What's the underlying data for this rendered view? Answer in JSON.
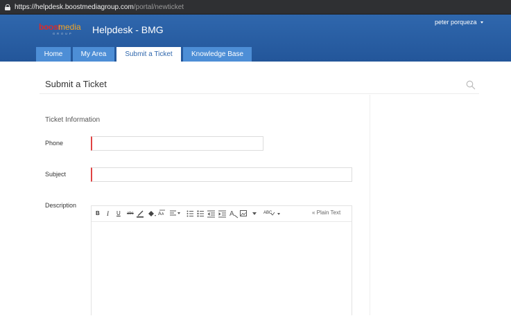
{
  "browser": {
    "url_host": "https://helpdesk.boostmediagroup.com",
    "url_path": "/portal/newticket"
  },
  "header": {
    "logo": {
      "boost": "boost",
      "media": "media",
      "group": "GROUP"
    },
    "title": "Helpdesk - BMG",
    "user_name": "peter porqueza"
  },
  "tabs": [
    {
      "label": "Home",
      "active": false
    },
    {
      "label": "My Area",
      "active": false
    },
    {
      "label": "Submit a Ticket",
      "active": true
    },
    {
      "label": "Knowledge Base",
      "active": false
    }
  ],
  "main": {
    "title": "Submit a Ticket",
    "section_title": "Ticket Information",
    "fields": {
      "phone": {
        "label": "Phone",
        "value": ""
      },
      "subject": {
        "label": "Subject",
        "value": ""
      },
      "description": {
        "label": "Description",
        "value": ""
      }
    },
    "editor": {
      "toolbar": {
        "bold": "B",
        "italic": "I",
        "underline": "U",
        "strike": "abc",
        "spell_check": "ABC",
        "plain_text": "« Plain Text"
      }
    }
  },
  "colors": {
    "header_blue": "#2f67ad",
    "tab_blue": "#4d8ed6",
    "required_red": "#e04343",
    "browser_bar": "#2f3033"
  },
  "icons": [
    "lock-icon",
    "caret-down-icon",
    "search-icon",
    "text-color-icon",
    "highlight-icon",
    "font-size-icon",
    "align-icon",
    "bullet-list-icon",
    "numbered-list-icon",
    "outdent-icon",
    "indent-icon",
    "clear-format-icon",
    "image-icon",
    "dropdown-icon",
    "spell-check-icon"
  ]
}
